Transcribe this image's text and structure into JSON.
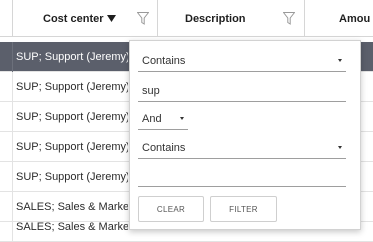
{
  "grid": {
    "columns": [
      {
        "label": "Cost center",
        "sorted": "descending",
        "filter_icon": "funnel-icon"
      },
      {
        "label": "Description",
        "filter_icon": "funnel-icon"
      },
      {
        "label": "Amou"
      }
    ],
    "rows": [
      {
        "cost_center": "SUP; Support (Jeremy)",
        "selected": true
      },
      {
        "cost_center": "SUP; Support (Jeremy)"
      },
      {
        "cost_center": "SUP; Support (Jeremy)"
      },
      {
        "cost_center": "SUP; Support (Jeremy)"
      },
      {
        "cost_center": "SUP; Support (Jeremy)"
      },
      {
        "cost_center": "SALES; Sales & Market"
      },
      {
        "cost_center": "SALES; Sales & Market"
      }
    ]
  },
  "filter_popup": {
    "condition1": "Contains",
    "value1": "sup",
    "operator": "And",
    "condition2": "Contains",
    "value2": "",
    "clear_label": "CLEAR",
    "filter_label": "FILTER"
  },
  "colors": {
    "selected_row_bg": "#5b5f6b",
    "selected_row_text": "#ffffff",
    "border": "#d6d6d6"
  }
}
